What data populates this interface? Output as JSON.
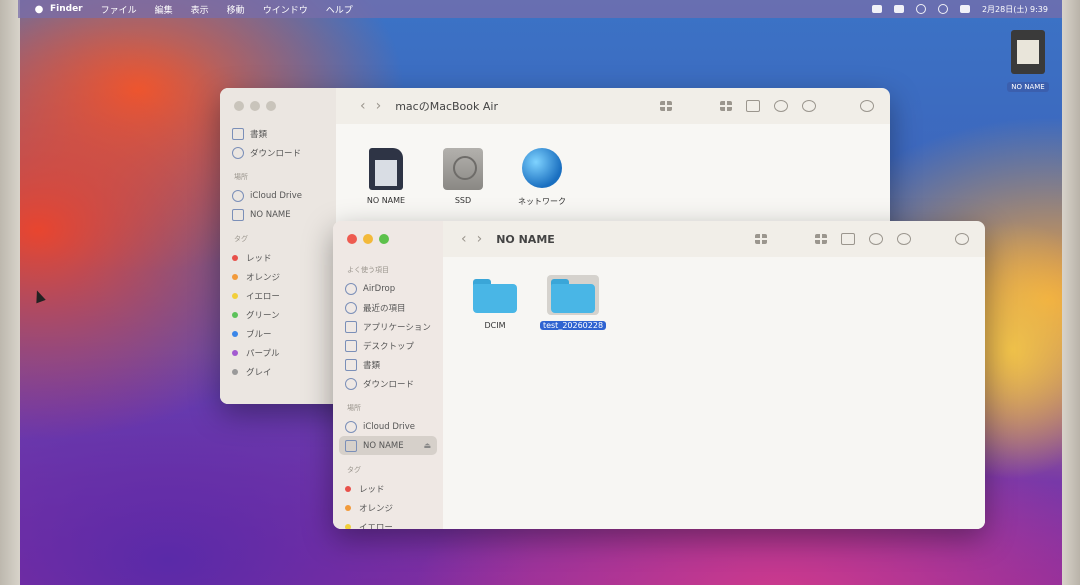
{
  "menubar": {
    "apple": "",
    "items": [
      "Finder",
      "ファイル",
      "編集",
      "表示",
      "移動",
      "ウインドウ",
      "ヘルプ"
    ],
    "clock": "2月28日(土) 9:39"
  },
  "desktop": {
    "icon_label": "NO NAME"
  },
  "back_window": {
    "title": "macのMacBook Air",
    "sidebar": {
      "favorites": [
        "書類",
        "ダウンロード"
      ],
      "locations_header": "場所",
      "locations": [
        "iCloud Drive",
        "NO NAME"
      ],
      "tags_header": "タグ",
      "tags": [
        {
          "label": "レッド",
          "color": "#e8504a"
        },
        {
          "label": "オレンジ",
          "color": "#f29a3a"
        },
        {
          "label": "イエロー",
          "color": "#f2cf3a"
        },
        {
          "label": "グリーン",
          "color": "#5cc25a"
        },
        {
          "label": "ブルー",
          "color": "#3a86e8"
        },
        {
          "label": "パープル",
          "color": "#a25ad0"
        },
        {
          "label": "グレイ",
          "color": "#9a9a9a"
        }
      ]
    },
    "items": [
      "NO NAME",
      "SSD",
      "ネットワーク"
    ]
  },
  "front_window": {
    "title": "NO NAME",
    "sidebar": {
      "favorites_header": "よく使う項目",
      "favorites": [
        "AirDrop",
        "最近の項目",
        "アプリケーション",
        "デスクトップ",
        "書類",
        "ダウンロード"
      ],
      "locations_header": "場所",
      "locations": [
        "iCloud Drive",
        "NO NAME"
      ],
      "tags_header": "タグ",
      "tags": [
        {
          "label": "レッド",
          "color": "#e8504a"
        },
        {
          "label": "オレンジ",
          "color": "#f29a3a"
        },
        {
          "label": "イエロー",
          "color": "#f2cf3a"
        }
      ]
    },
    "items": [
      "DCIM",
      "test_20260228"
    ]
  }
}
